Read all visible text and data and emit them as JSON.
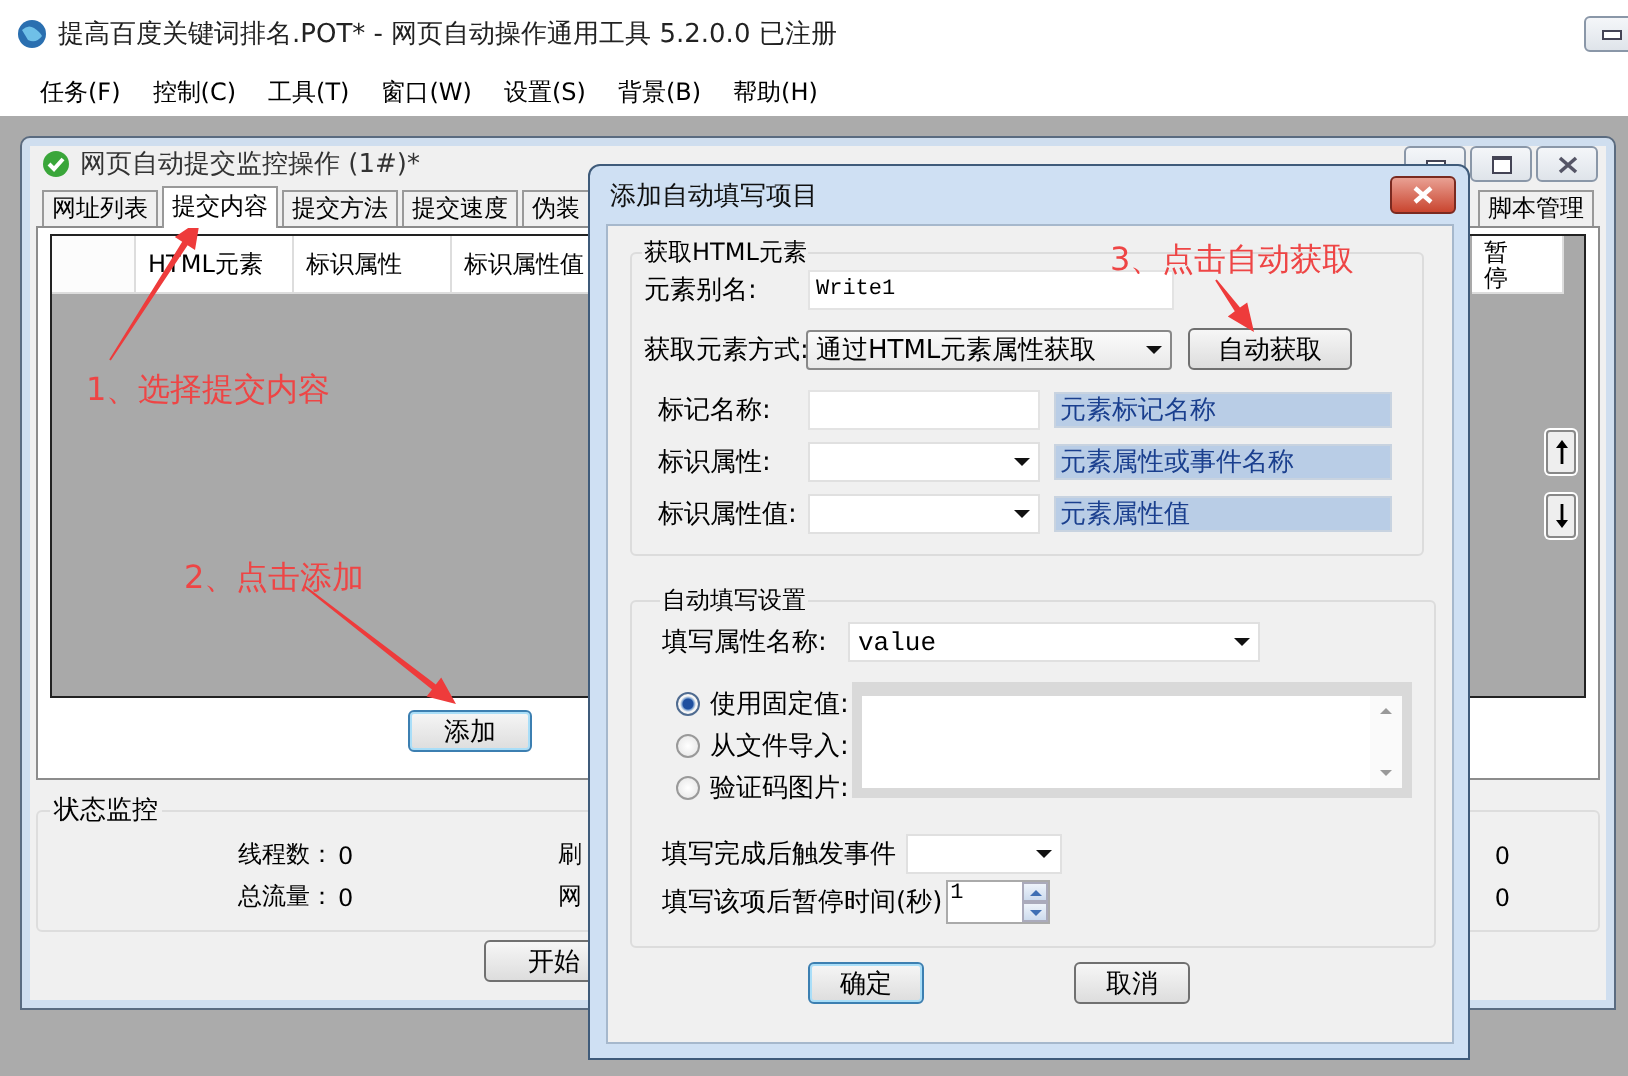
{
  "window": {
    "title": "提高百度关键词排名.POT* - 网页自动操作通用工具 5.2.0.0  已注册"
  },
  "menu": [
    "任务(F)",
    "控制(C)",
    "工具(T)",
    "窗口(W)",
    "设置(S)",
    "背景(B)",
    "帮助(H)"
  ],
  "child_window": {
    "title": "网页自动提交监控操作  (1#)*",
    "tabs": [
      {
        "label": "网址列表",
        "selected": false
      },
      {
        "label": "提交内容",
        "selected": true
      },
      {
        "label": "提交方法",
        "selected": false
      },
      {
        "label": "提交速度",
        "selected": false
      },
      {
        "label": "伪装",
        "selected": false
      },
      {
        "label": "脚本管理",
        "selected": false
      }
    ],
    "table": {
      "columns": [
        "HTML元素",
        "标识属性",
        "标识属性值",
        "暂停"
      ]
    },
    "add_button": "添加",
    "status": {
      "title": "状态监控",
      "stats": [
        {
          "label": "线程数：",
          "value": "0"
        },
        {
          "label": "总流量：",
          "value": "0"
        }
      ],
      "cut_labels": [
        "刷",
        "网"
      ],
      "right_values": [
        "0",
        "0"
      ]
    },
    "start_button": "开始"
  },
  "dialog": {
    "title": "添加自动填写项目",
    "group1": {
      "title": "获取HTML元素",
      "alias_label": "元素别名:",
      "alias_value": "Write1",
      "method_label": "获取元素方式:",
      "method_value": "通过HTML元素属性获取",
      "auto_button": "自动获取",
      "rows": [
        {
          "kind": "input",
          "label": "标记名称:",
          "hint": "元素标记名称"
        },
        {
          "kind": "select",
          "label": "标识属性:",
          "hint": "元素属性或事件名称"
        },
        {
          "kind": "select",
          "label": "标识属性值:",
          "hint": "元素属性值"
        }
      ]
    },
    "group2": {
      "title": "自动填写设置",
      "attr_label": "填写属性名称:",
      "attr_value": "value",
      "radios": [
        {
          "label": "使用固定值:",
          "selected": true
        },
        {
          "label": "从文件导入:",
          "selected": false
        },
        {
          "label": "验证码图片:",
          "selected": false
        }
      ],
      "event_label": "填写完成后触发事件",
      "pause_label": "填写该项后暂停时间(秒)",
      "pause_value": "1"
    },
    "buttons": [
      "确定",
      "取消"
    ]
  },
  "annotations": [
    {
      "text": "1、选择提交内容"
    },
    {
      "text": "2、点击添加"
    },
    {
      "text": "3、点击自动获取"
    }
  ]
}
